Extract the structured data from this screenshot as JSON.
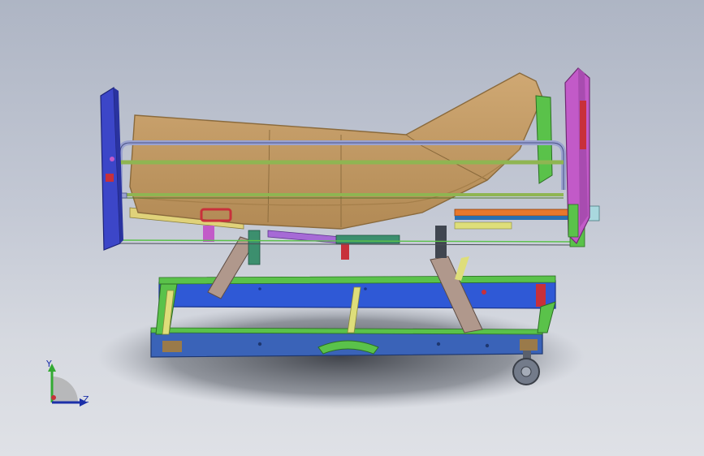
{
  "view": {
    "background_top": "#aeb5c4",
    "background_bottom": "#dfe1e6"
  },
  "colors": {
    "mattress": "#c19a63",
    "mattress_edge": "#8a6a3c",
    "frame_blue": "#2f59d6",
    "frame_dark_blue": "#3a63b8",
    "frame_green": "#5ac24a",
    "headboard": "#c25ac8",
    "footboard": "#3c46c8",
    "side_rail": "#9aa2cf",
    "link_arm": "#b0988c",
    "yellow_strut": "#dede7a",
    "wheel": "#737b8a",
    "red_accent": "#c8303a"
  },
  "triad": {
    "y_label": "Y",
    "z_label": "Z",
    "y_color": "#33aa33",
    "z_color": "#1b2fa8"
  },
  "icons": {
    "triad": "coordinate-triad-icon"
  }
}
